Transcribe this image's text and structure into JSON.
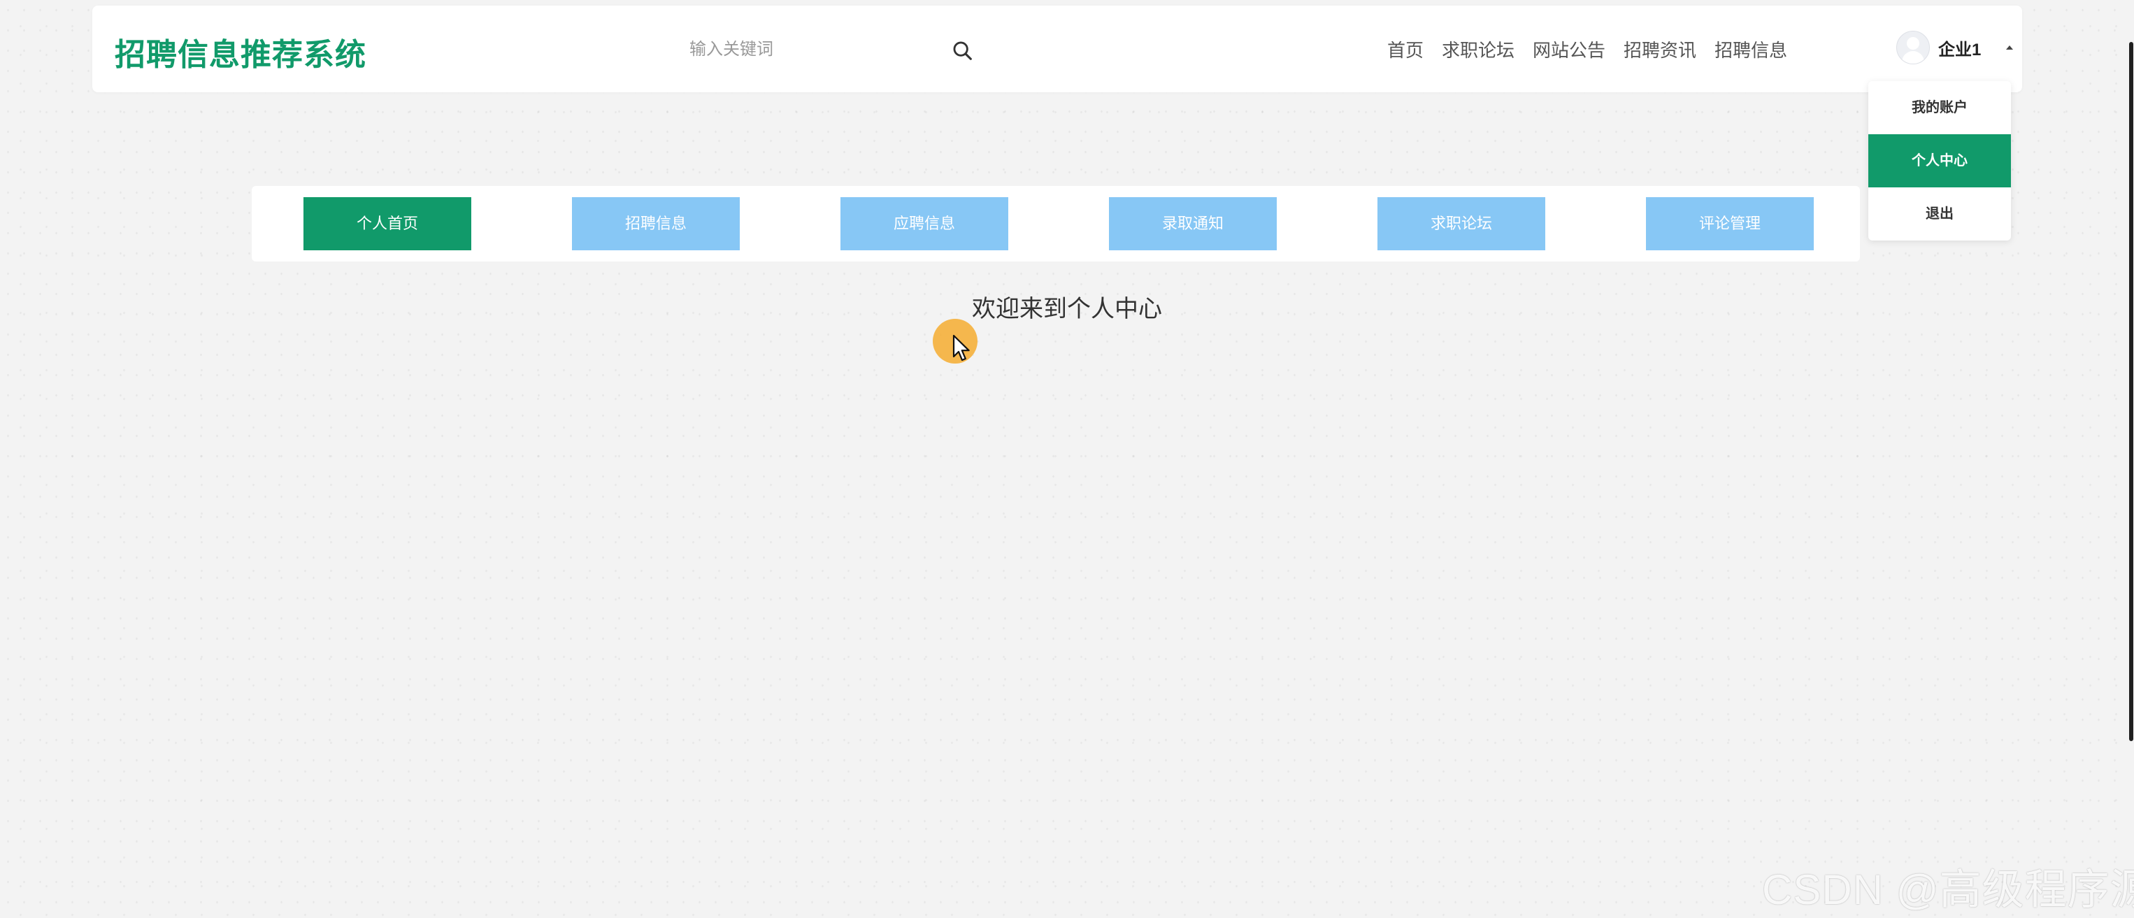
{
  "header": {
    "logo_text": "招聘信息推荐系统",
    "search": {
      "placeholder": "输入关键词",
      "value": ""
    },
    "nav_items": [
      "首页",
      "求职论坛",
      "网站公告",
      "招聘资讯",
      "招聘信息"
    ],
    "user": {
      "name": "企业1"
    }
  },
  "dropdown": {
    "items": [
      "我的账户",
      "个人中心",
      "退出"
    ],
    "active": "个人中心"
  },
  "tabs": {
    "items": [
      "个人首页",
      "招聘信息",
      "应聘信息",
      "录取通知",
      "求职论坛",
      "评论管理"
    ],
    "active": "个人首页"
  },
  "main": {
    "welcome_text": "欢迎来到个人中心"
  },
  "watermark": "CSDN @高级程序源",
  "colors": {
    "brand_green": "#119a6a",
    "tab_inactive": "#87c7f5",
    "cursor_highlight": "#f5aa28",
    "background": "#f3f3f3"
  },
  "icons": {
    "search": "search-icon",
    "avatar": "user-avatar-icon",
    "caret": "caret-up-icon",
    "cursor": "mouse-cursor-icon"
  }
}
